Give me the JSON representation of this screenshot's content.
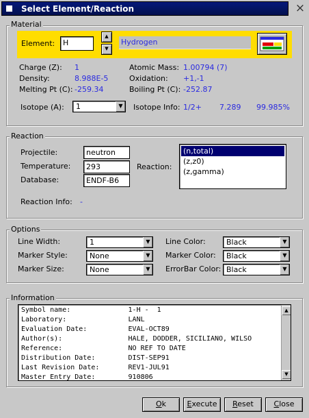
{
  "window": {
    "title": "Select Element/Reaction",
    "close_glyph": "×"
  },
  "material": {
    "legend": "Material",
    "element_label": "Element:",
    "element_value": "H",
    "element_name": "Hydrogen",
    "props": {
      "charge_label": "Charge (Z):",
      "charge_value": "1",
      "density_label": "Density:",
      "density_value": "8.988E-5",
      "melting_label": "Melting Pt (C):",
      "melting_value": "-259.34",
      "mass_label": "Atomic Mass:",
      "mass_value": "1.00794 (7)",
      "oxidation_label": "Oxidation:",
      "oxidation_value": "+1,-1",
      "boiling_label": "Boiling Pt (C):",
      "boiling_value": "-252.87"
    },
    "isotope_label": "Isotope (A):",
    "isotope_value": "1",
    "isotope_info_label": "Isotope Info:",
    "isotope_info": {
      "spin": "1/2+",
      "mass_excess": "7.289",
      "abundance": "99.985%"
    }
  },
  "reaction": {
    "legend": "Reaction",
    "projectile_label": "Projectile:",
    "projectile_value": "neutron",
    "temperature_label": "Temperature:",
    "temperature_value": "293",
    "database_label": "Database:",
    "database_value": "ENDF-B6",
    "reaction_label": "Reaction:",
    "reactions": [
      "(n,total)",
      "(z,z0)",
      "(z,gamma)"
    ],
    "reaction_info_label": "Reaction Info:",
    "reaction_info_value": "-"
  },
  "options": {
    "legend": "Options",
    "line_width_label": "Line Width:",
    "line_width_value": "1",
    "marker_style_label": "Marker Style:",
    "marker_style_value": "None",
    "marker_size_label": "Marker Size:",
    "marker_size_value": "None",
    "line_color_label": "Line Color:",
    "line_color_value": "Black",
    "marker_color_label": "Marker Color:",
    "marker_color_value": "Black",
    "errorbar_color_label": "ErrorBar Color:",
    "errorbar_color_value": "Black"
  },
  "information": {
    "legend": "Information",
    "lines": [
      "Symbol name:              1-H -  1",
      "Laboratory:               LANL",
      "Evaluation Date:          EVAL-OCT89",
      "Author(s):                HALE, DODDER, SICILIANO, WILSO",
      "Reference:                NO REF TO DATE",
      "Distribution Date:        DIST-SEP91",
      "Last Revision Date:       REV1-JUL91",
      "Master Entry Date:        910806"
    ]
  },
  "buttons": {
    "ok_pre": "",
    "ok_u": "O",
    "ok_post": "k",
    "execute_pre": "",
    "execute_u": "E",
    "execute_post": "xecute",
    "reset_pre": "",
    "reset_u": "R",
    "reset_post": "eset",
    "close_pre": "",
    "close_u": "C",
    "close_post": "lose"
  },
  "colors": {
    "accent_blue": "#2a2ae0",
    "title_bar": "#04187a",
    "element_panel": "#ffdd00",
    "selection": "#000070"
  }
}
